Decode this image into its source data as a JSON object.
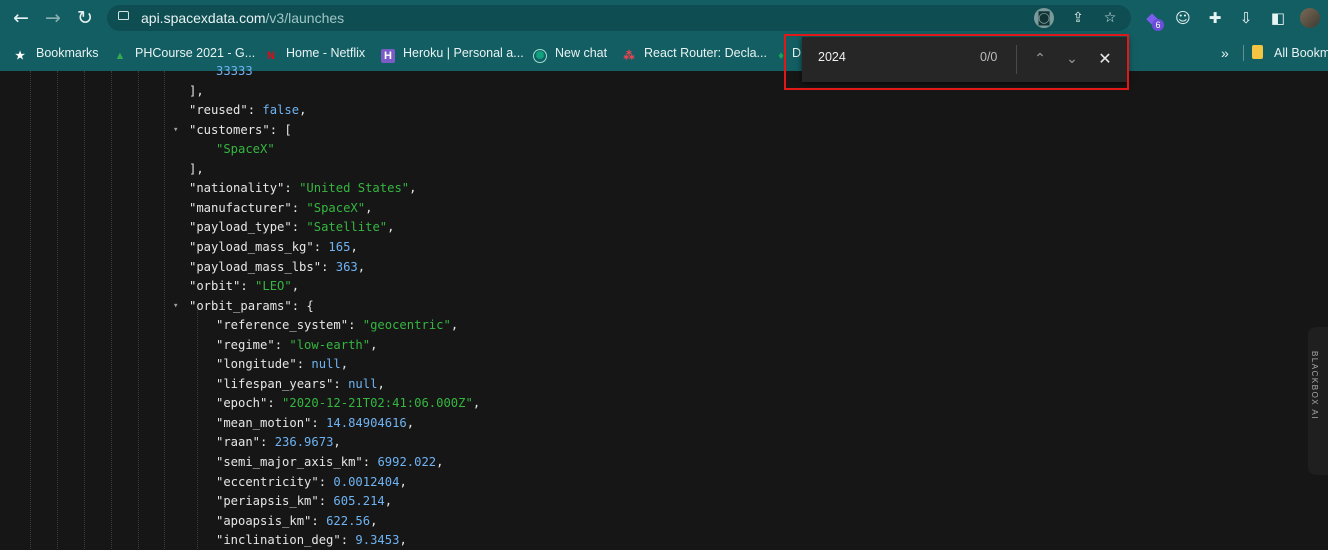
{
  "browser": {
    "url_host": "api.spacexdata.com",
    "url_path": "/v3/launches",
    "extension_badge": "6",
    "bookmarks": [
      {
        "label": "Bookmarks",
        "icon": "star-icon",
        "color": "#ffffff"
      },
      {
        "label": "PHCourse 2021 - G...",
        "icon": "google-drive-icon",
        "color": "#34a853"
      },
      {
        "label": "Home - Netflix",
        "icon": "netflix-icon",
        "color": "#e50914"
      },
      {
        "label": "Heroku | Personal a...",
        "icon": "heroku-icon",
        "color": "#7b5cc7"
      },
      {
        "label": "New chat",
        "icon": "chatgpt-icon",
        "color": "#10a37f"
      },
      {
        "label": "React Router: Decla...",
        "icon": "react-router-icon",
        "color": "#f44250"
      },
      {
        "label": "D",
        "icon": "mongodb-icon",
        "color": "#13aa52"
      },
      {
        "label": "All Bookm",
        "icon": "folder-icon",
        "color": "#f4c542"
      }
    ],
    "overflow_chevron": "»"
  },
  "find_bar": {
    "query": "2024",
    "count": "0/0"
  },
  "json_lines": [
    {
      "indent": 1,
      "parts": [
        {
          "t": "num",
          "v": "33333"
        }
      ]
    },
    {
      "indent": 0,
      "parts": [
        {
          "t": "key",
          "v": "],"
        }
      ]
    },
    {
      "indent": 0,
      "parts": [
        {
          "t": "key",
          "v": "\"reused\": "
        },
        {
          "t": "kw",
          "v": "false"
        },
        {
          "t": "key",
          "v": ","
        }
      ]
    },
    {
      "indent": 0,
      "arrow": true,
      "parts": [
        {
          "t": "key",
          "v": "\"customers\": ["
        }
      ]
    },
    {
      "indent": 1,
      "parts": [
        {
          "t": "str",
          "v": "\"SpaceX\""
        }
      ]
    },
    {
      "indent": 0,
      "parts": [
        {
          "t": "key",
          "v": "],"
        }
      ]
    },
    {
      "indent": 0,
      "parts": [
        {
          "t": "key",
          "v": "\"nationality\": "
        },
        {
          "t": "str",
          "v": "\"United States\""
        },
        {
          "t": "key",
          "v": ","
        }
      ]
    },
    {
      "indent": 0,
      "parts": [
        {
          "t": "key",
          "v": "\"manufacturer\": "
        },
        {
          "t": "str",
          "v": "\"SpaceX\""
        },
        {
          "t": "key",
          "v": ","
        }
      ]
    },
    {
      "indent": 0,
      "parts": [
        {
          "t": "key",
          "v": "\"payload_type\": "
        },
        {
          "t": "str",
          "v": "\"Satellite\""
        },
        {
          "t": "key",
          "v": ","
        }
      ]
    },
    {
      "indent": 0,
      "parts": [
        {
          "t": "key",
          "v": "\"payload_mass_kg\": "
        },
        {
          "t": "num",
          "v": "165"
        },
        {
          "t": "key",
          "v": ","
        }
      ]
    },
    {
      "indent": 0,
      "parts": [
        {
          "t": "key",
          "v": "\"payload_mass_lbs\": "
        },
        {
          "t": "num",
          "v": "363"
        },
        {
          "t": "key",
          "v": ","
        }
      ]
    },
    {
      "indent": 0,
      "parts": [
        {
          "t": "key",
          "v": "\"orbit\": "
        },
        {
          "t": "str",
          "v": "\"LEO\""
        },
        {
          "t": "key",
          "v": ","
        }
      ]
    },
    {
      "indent": 0,
      "arrow": true,
      "parts": [
        {
          "t": "key",
          "v": "\"orbit_params\": {"
        }
      ]
    },
    {
      "indent": 1,
      "parts": [
        {
          "t": "key",
          "v": "\"reference_system\": "
        },
        {
          "t": "str",
          "v": "\"geocentric\""
        },
        {
          "t": "key",
          "v": ","
        }
      ]
    },
    {
      "indent": 1,
      "parts": [
        {
          "t": "key",
          "v": "\"regime\": "
        },
        {
          "t": "str",
          "v": "\"low-earth\""
        },
        {
          "t": "key",
          "v": ","
        }
      ]
    },
    {
      "indent": 1,
      "parts": [
        {
          "t": "key",
          "v": "\"longitude\": "
        },
        {
          "t": "kw",
          "v": "null"
        },
        {
          "t": "key",
          "v": ","
        }
      ]
    },
    {
      "indent": 1,
      "parts": [
        {
          "t": "key",
          "v": "\"lifespan_years\": "
        },
        {
          "t": "kw",
          "v": "null"
        },
        {
          "t": "key",
          "v": ","
        }
      ]
    },
    {
      "indent": 1,
      "parts": [
        {
          "t": "key",
          "v": "\"epoch\": "
        },
        {
          "t": "str",
          "v": "\"2020-12-21T02:41:06.000Z\""
        },
        {
          "t": "key",
          "v": ","
        }
      ]
    },
    {
      "indent": 1,
      "parts": [
        {
          "t": "key",
          "v": "\"mean_motion\": "
        },
        {
          "t": "num",
          "v": "14.84904616"
        },
        {
          "t": "key",
          "v": ","
        }
      ]
    },
    {
      "indent": 1,
      "parts": [
        {
          "t": "key",
          "v": "\"raan\": "
        },
        {
          "t": "num",
          "v": "236.9673"
        },
        {
          "t": "key",
          "v": ","
        }
      ]
    },
    {
      "indent": 1,
      "parts": [
        {
          "t": "key",
          "v": "\"semi_major_axis_km\": "
        },
        {
          "t": "num",
          "v": "6992.022"
        },
        {
          "t": "key",
          "v": ","
        }
      ]
    },
    {
      "indent": 1,
      "parts": [
        {
          "t": "key",
          "v": "\"eccentricity\": "
        },
        {
          "t": "num",
          "v": "0.0012404"
        },
        {
          "t": "key",
          "v": ","
        }
      ]
    },
    {
      "indent": 1,
      "parts": [
        {
          "t": "key",
          "v": "\"periapsis_km\": "
        },
        {
          "t": "num",
          "v": "605.214"
        },
        {
          "t": "key",
          "v": ","
        }
      ]
    },
    {
      "indent": 1,
      "parts": [
        {
          "t": "key",
          "v": "\"apoapsis_km\": "
        },
        {
          "t": "num",
          "v": "622.56"
        },
        {
          "t": "key",
          "v": ","
        }
      ]
    },
    {
      "indent": 1,
      "parts": [
        {
          "t": "key",
          "v": "\"inclination_deg\": "
        },
        {
          "t": "num",
          "v": "9.3453"
        },
        {
          "t": "key",
          "v": ","
        }
      ]
    }
  ],
  "side_panel": {
    "label": "BLACKBOX AI"
  },
  "colors": {
    "toolbar": "#135e63",
    "page_bg": "#161616",
    "string": "#35b640",
    "number": "#6fb3f2",
    "highlight_box": "#e01818"
  }
}
